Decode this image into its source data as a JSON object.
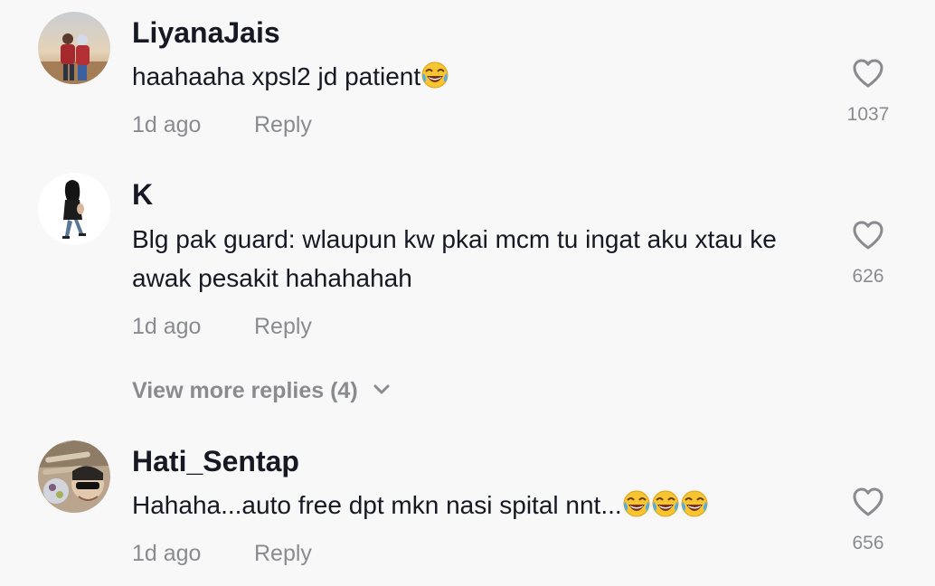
{
  "comments": [
    {
      "username": "LiyanaJais",
      "text": "haahaaha xpsl2 jd patient",
      "emoji_count": 1,
      "time": "1d ago",
      "reply_label": "Reply",
      "likes": "1037"
    },
    {
      "username": "K",
      "text": "Blg pak guard: wlaupun kw pkai mcm tu ingat aku xtau ke awak pesakit hahahahah",
      "emoji_count": 0,
      "time": "1d ago",
      "reply_label": "Reply",
      "likes": "626",
      "view_more": "View more replies (4)"
    },
    {
      "username": "Hati_Sentap",
      "text": "Hahaha...auto free dpt mkn nasi spital nnt...",
      "emoji_count": 3,
      "time": "1d ago",
      "reply_label": "Reply",
      "likes": "656"
    }
  ],
  "icons": {
    "like": "heart-outline-icon",
    "expand": "chevron-down-icon",
    "emoji": "face-with-tears-of-joy-emoji"
  },
  "colors": {
    "background": "#f8f8f8",
    "primary_text": "#161823",
    "secondary_text": "#8a8b91"
  }
}
